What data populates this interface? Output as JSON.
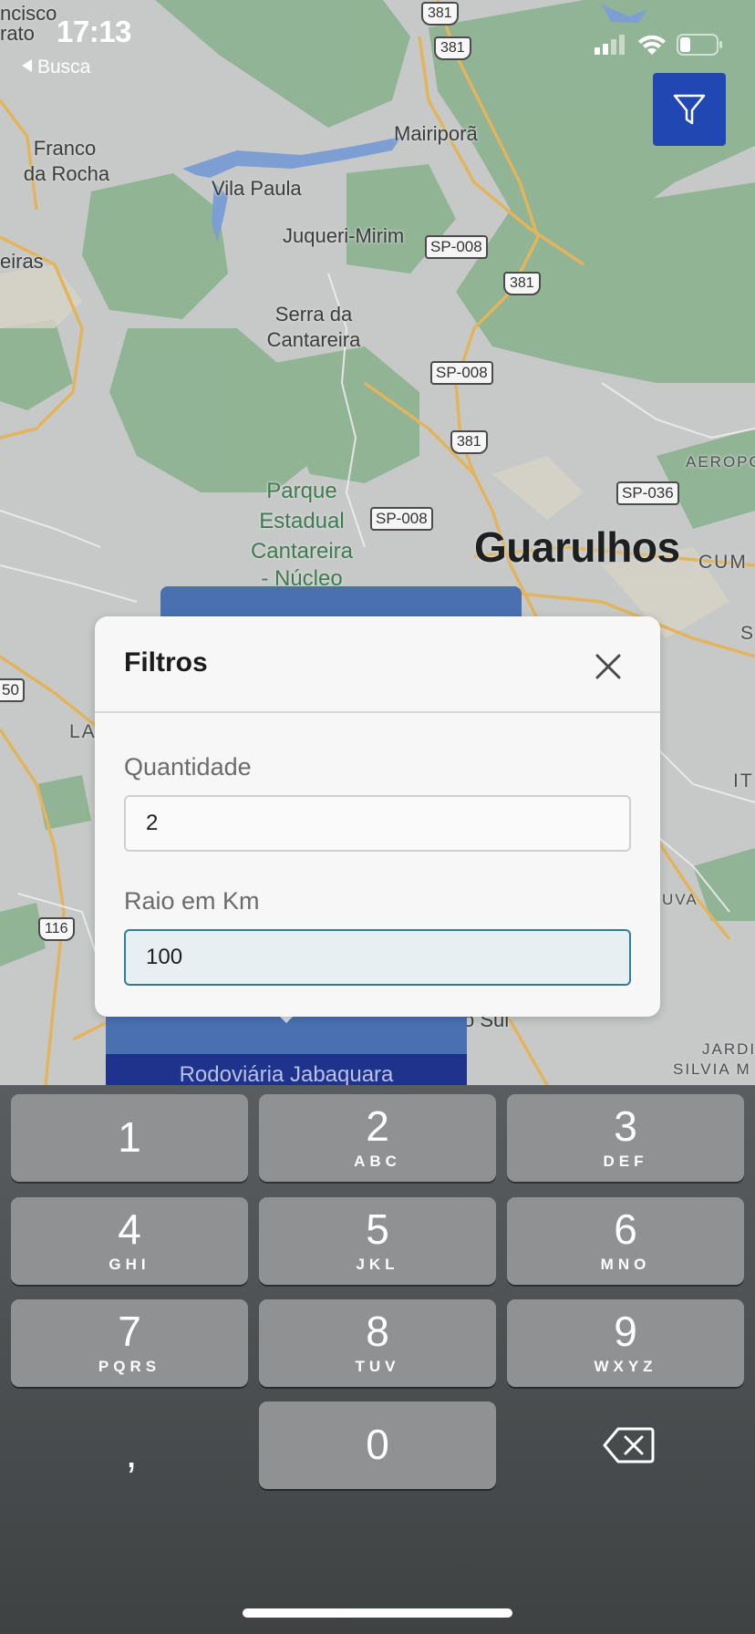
{
  "status_bar": {
    "time": "17:13",
    "back_label": "Busca",
    "left_edge_text_1": "ncisco",
    "left_edge_text_2": "rato"
  },
  "map": {
    "places": {
      "franco_da_rocha_1": "Franco",
      "franco_da_rocha_2": "da Rocha",
      "mairipora": "Mairiporã",
      "vila_paula": "Vila Paula",
      "juqueri_mirim": "Juqueri-Mirim",
      "eiras": "eiras",
      "serra_1": "Serra da",
      "serra_2": "Cantareira",
      "parque_1": "Parque",
      "parque_2": "Estadual",
      "parque_3": "Cantareira",
      "parque_4": "- Núcleo",
      "guarulhos": "Guarulhos",
      "aeropo": "AEROPO",
      "cum": "CUM",
      "s_edge": "S",
      "it_edge": "IT",
      "uva": "UVA",
      "la_edge": "LA",
      "jardi": "JARDI",
      "silvia": "SILVIA M",
      "sul": "o Sul"
    },
    "roads": {
      "r381_a": "381",
      "r381_b": "381",
      "r381_c": "381",
      "r381_d": "381",
      "sp008_a": "SP-008",
      "sp008_b": "SP-008",
      "sp008_c": "SP-008",
      "sp036": "SP-036",
      "r50": "50",
      "r116": "116"
    },
    "info_card_footer": "Rodoviária Jabaquara",
    "colors": {
      "land": "#c9ccca",
      "forest": "#8fb393",
      "water": "#7d9ed2",
      "highway": "#e8b75a",
      "filter_button": "#2147b3"
    }
  },
  "modal": {
    "title": "Filtros",
    "close_icon": "close-icon",
    "quantity_label": "Quantidade",
    "quantity_value": "2",
    "radius_label": "Raio em Km",
    "radius_value": "100"
  },
  "keyboard": {
    "keys": [
      {
        "digit": "1",
        "letters": ""
      },
      {
        "digit": "2",
        "letters": "ABC"
      },
      {
        "digit": "3",
        "letters": "DEF"
      },
      {
        "digit": "4",
        "letters": "GHI"
      },
      {
        "digit": "5",
        "letters": "JKL"
      },
      {
        "digit": "6",
        "letters": "MNO"
      },
      {
        "digit": "7",
        "letters": "PQRS"
      },
      {
        "digit": "8",
        "letters": "TUV"
      },
      {
        "digit": "9",
        "letters": "WXYZ"
      },
      {
        "digit": "0",
        "letters": ""
      }
    ],
    "comma": ",",
    "backspace_icon": "backspace-icon"
  }
}
